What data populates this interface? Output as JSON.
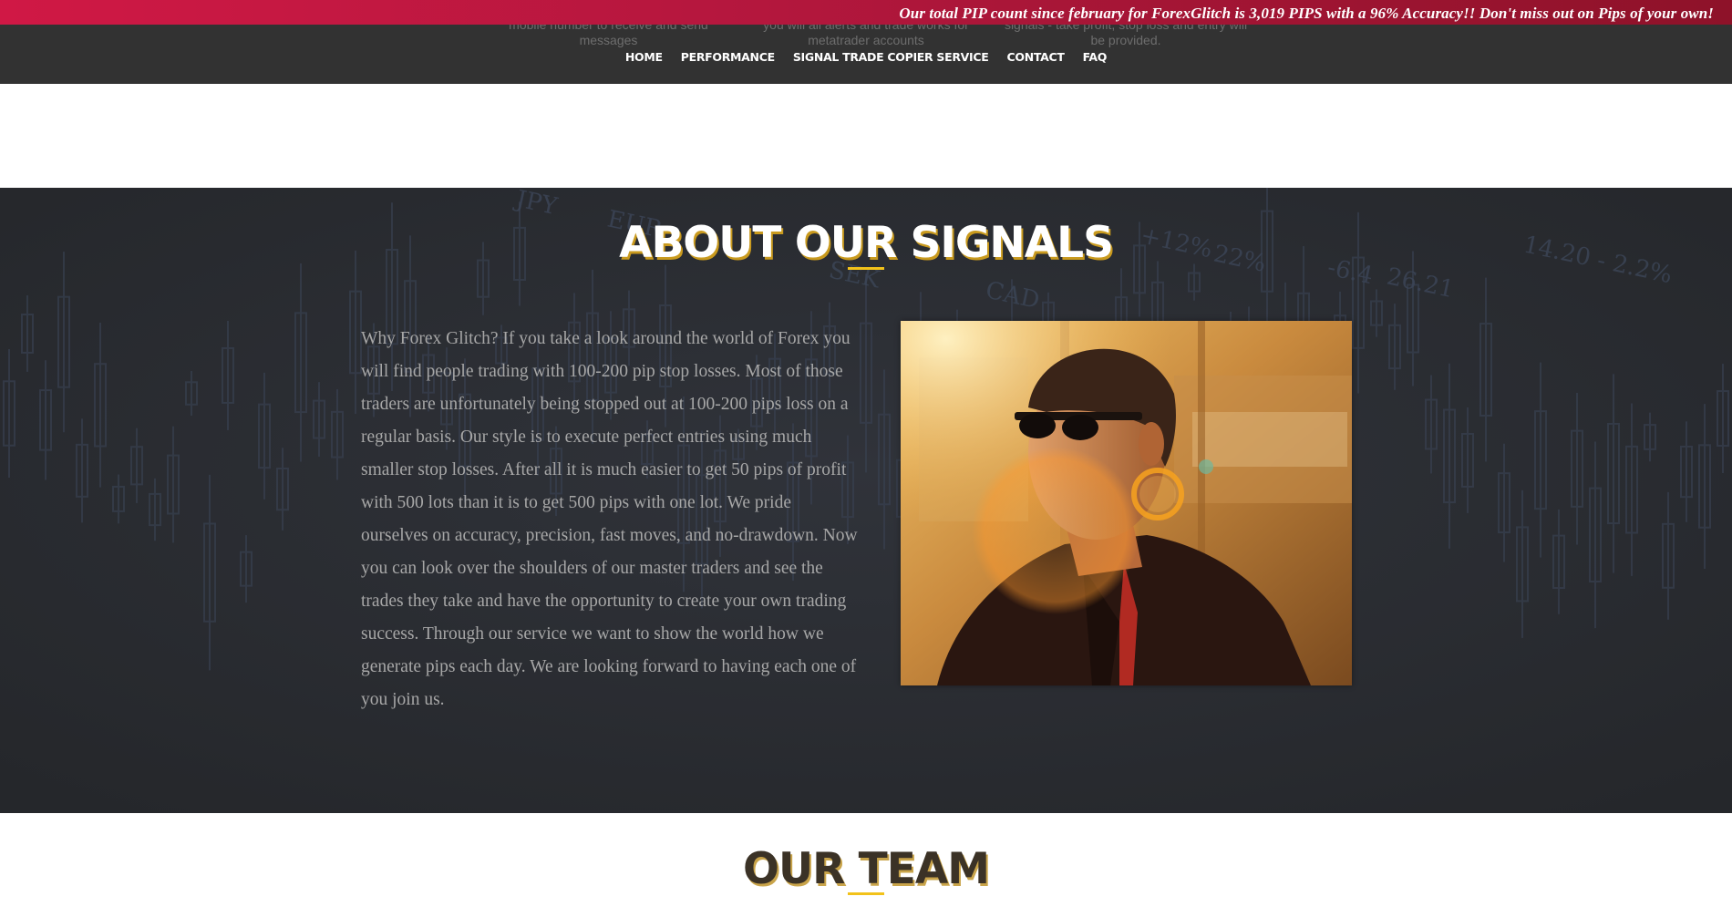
{
  "ticker": {
    "text": "Our total PIP count since february for ForexGlitch is 3,019 PIPS with a 96% Accuracy!!  Don't miss out on Pips of your own!"
  },
  "header": {
    "ghost_text": [
      "mobile number to receive and send messages",
      "you will all alerts and trade works for metatrader accounts",
      "signals - take profit, stop loss and entry will be provided."
    ],
    "nav": [
      "HOME",
      "PERFORMANCE",
      "SIGNAL TRADE COPIER SERVICE",
      "CONTACT",
      "FAQ"
    ]
  },
  "about": {
    "title": "ABOUT OUR SIGNALS",
    "paragraph": "Why Forex Glitch? If you take a look around the world of Forex you will find people trading with 100-200 pip stop losses. Most of those traders are unfortunately being stopped out at 100-200 pips loss on a regular basis. Our style is to execute perfect entries using much smaller stop losses. After all it is much easier to get 50 pips of profit with 500 lots than it is to get 500 pips with one lot. We pride ourselves on accuracy, precision, fast moves, and no-drawdown. Now you can look over the shoulders of our master traders and see the trades they take and have the opportunity to create your own trading success. Through our service we want to show the world how we generate pips each day. We are looking forward to having each one of you join us.",
    "bg_labels": [
      "JPY",
      "EUR",
      "SEK",
      "CAD",
      "+12%",
      "22%",
      "-6.4",
      "26.21",
      "14.20 - 2.2%"
    ]
  },
  "team": {
    "title": "OUR TEAM"
  },
  "colors": {
    "ticker_start": "#d01845",
    "ticker_end": "#8e1229",
    "header_bg": "#323232",
    "about_bg": "#2a2c30",
    "accent_gold": "#f2c21a"
  }
}
